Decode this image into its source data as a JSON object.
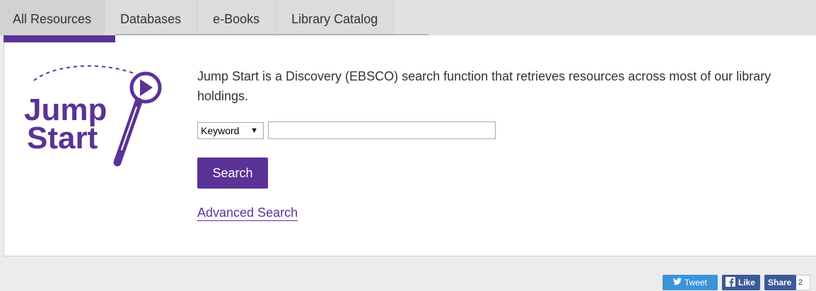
{
  "tabs": [
    {
      "label": "All Resources",
      "active": true
    },
    {
      "label": "Databases",
      "active": false
    },
    {
      "label": "e-Books",
      "active": false
    },
    {
      "label": "Library Catalog",
      "active": false
    }
  ],
  "logo": {
    "line1": "Jump",
    "line2": "Start",
    "icon": "magnifier-play-icon"
  },
  "description": "Jump Start is a Discovery (EBSCO) search function that retrieves resources across most of our library holdings.",
  "search": {
    "field_selected": "Keyword",
    "input_value": "",
    "button_label": "Search",
    "advanced_label": "Advanced Search"
  },
  "social": {
    "tweet_label": "Tweet",
    "like_label": "Like",
    "share_label": "Share",
    "share_count": "2"
  },
  "colors": {
    "brand": "#5b3296",
    "twitter": "#3b94d9",
    "facebook": "#3b5a98"
  }
}
